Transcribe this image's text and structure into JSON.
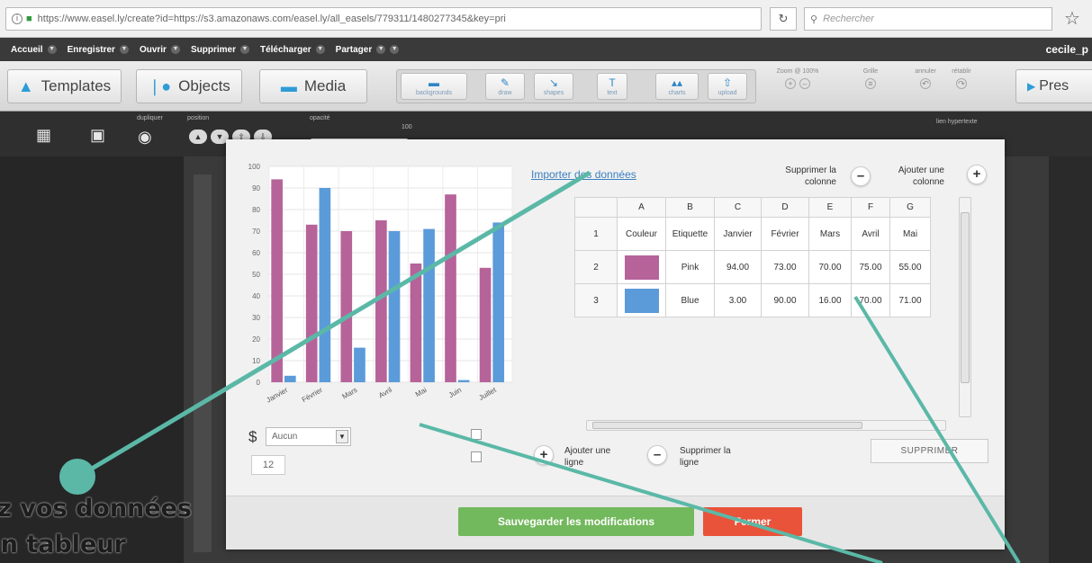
{
  "browser": {
    "url": "https://www.easel.ly/create?id=https://s3.amazonaws.com/easel.ly/all_easels/779311/1480277345&key=pri",
    "search_placeholder": "Rechercher"
  },
  "menu": {
    "items": [
      "Accueil",
      "Enregistrer",
      "Ouvrir",
      "Supprimer",
      "Télécharger",
      "Partager"
    ],
    "username": "cecile_p"
  },
  "toolbar": {
    "templates": "Templates",
    "objects": "Objects",
    "media": "Media",
    "tools": [
      "backgrounds",
      "draw",
      "shapes",
      "text",
      "charts",
      "upload"
    ],
    "zoom": "Zoom @ 100%",
    "grid": "Grille",
    "undo": "annuler",
    "redo": "rétablir",
    "present": "Pres"
  },
  "toolbar2": {
    "duplicate": "dupliquer",
    "position": "position",
    "opacity": "opacité",
    "opacity_value": "100",
    "link": "lien hypertexte"
  },
  "modal": {
    "import_link": "Importer des données",
    "remove_column": "Supprimer la colonne",
    "add_column": "Ajouter une colonne",
    "add_row": "Ajouter une ligne",
    "remove_row": "Supprimer la ligne",
    "delete_button": "SUPPRIMER",
    "save_button": "Sauvegarder les modifications",
    "close_button": "Fermer",
    "currency_symbol": "$",
    "currency_select": "Aucun",
    "font_size": "12"
  },
  "table": {
    "col_letters": [
      "A",
      "B",
      "C",
      "D",
      "E",
      "F",
      "G"
    ],
    "rows": [
      {
        "num": "1",
        "cells": [
          "Couleur",
          "Etiquette",
          "Janvier",
          "Février",
          "Mars",
          "Avril",
          "Mai"
        ]
      },
      {
        "num": "2",
        "color": "#b6639a",
        "cells": [
          "",
          "Pink",
          "94.00",
          "73.00",
          "70.00",
          "75.00",
          "55.00"
        ]
      },
      {
        "num": "3",
        "color": "#5b9bd9",
        "cells": [
          "",
          "Blue",
          "3.00",
          "90.00",
          "16.00",
          "70.00",
          "71.00"
        ]
      }
    ]
  },
  "chart_data": {
    "type": "bar",
    "categories": [
      "Janvier",
      "Février",
      "Mars",
      "Avril",
      "Mai",
      "Juin",
      "Juillet"
    ],
    "series": [
      {
        "name": "Pink",
        "color": "#b6639a",
        "values": [
          94,
          73,
          70,
          75,
          55,
          87,
          53
        ]
      },
      {
        "name": "Blue",
        "color": "#5b9bd9",
        "values": [
          3,
          90,
          16,
          70,
          71,
          1,
          74
        ]
      }
    ],
    "ylim": [
      0,
      100
    ],
    "yticks": [
      0,
      10,
      20,
      30,
      40,
      50,
      60,
      70,
      80,
      90,
      100
    ],
    "grid": true
  },
  "overlay": {
    "line1": "tez vos données",
    "line2": "s un tableur",
    "accent": "#5bb8a7"
  }
}
